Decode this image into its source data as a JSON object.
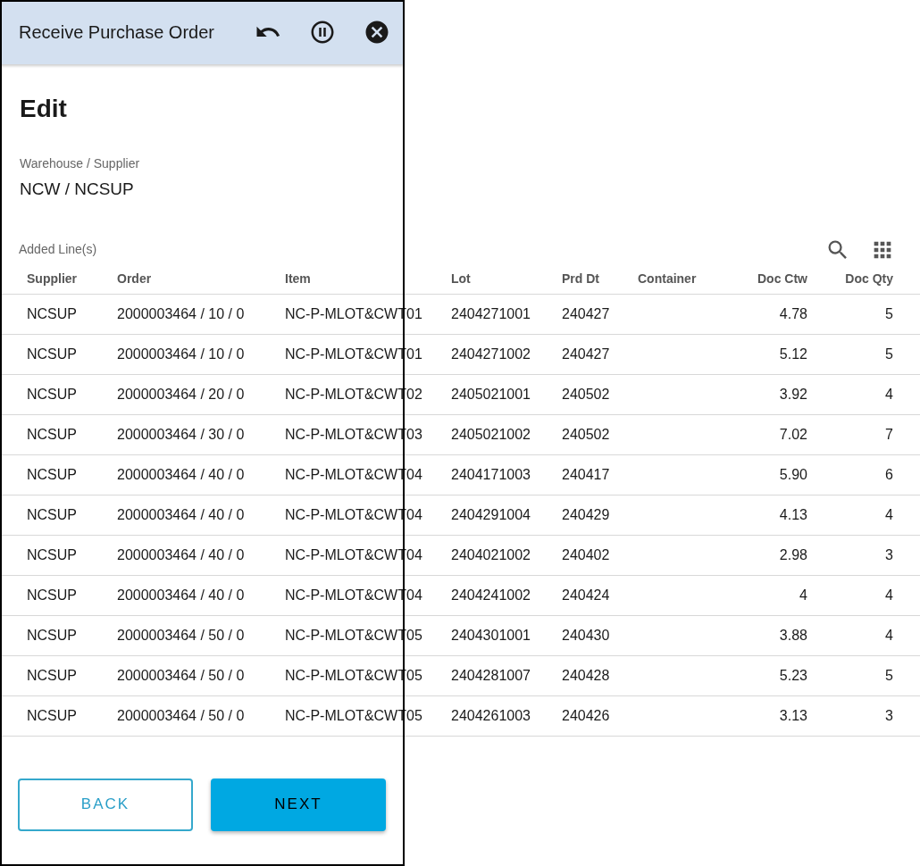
{
  "header": {
    "title": "Receive Purchase Order"
  },
  "page_title": "Edit",
  "field": {
    "label": "Warehouse / Supplier",
    "value": "NCW / NCSUP"
  },
  "section_label": "Added Line(s)",
  "table": {
    "columns": [
      "Supplier",
      "Order",
      "Item",
      "Lot",
      "Prd Dt",
      "Container",
      "Doc Ctw",
      "Doc Qty"
    ],
    "rows": [
      [
        "NCSUP",
        "2000003464 / 10 / 0",
        "NC-P-MLOT&CWT01",
        "2404271001",
        "240427",
        "",
        "4.78",
        "5"
      ],
      [
        "NCSUP",
        "2000003464 / 10 / 0",
        "NC-P-MLOT&CWT01",
        "2404271002",
        "240427",
        "",
        "5.12",
        "5"
      ],
      [
        "NCSUP",
        "2000003464 / 20 / 0",
        "NC-P-MLOT&CWT02",
        "2405021001",
        "240502",
        "",
        "3.92",
        "4"
      ],
      [
        "NCSUP",
        "2000003464 / 30 / 0",
        "NC-P-MLOT&CWT03",
        "2405021002",
        "240502",
        "",
        "7.02",
        "7"
      ],
      [
        "NCSUP",
        "2000003464 / 40 / 0",
        "NC-P-MLOT&CWT04",
        "2404171003",
        "240417",
        "",
        "5.90",
        "6"
      ],
      [
        "NCSUP",
        "2000003464 / 40 / 0",
        "NC-P-MLOT&CWT04",
        "2404291004",
        "240429",
        "",
        "4.13",
        "4"
      ],
      [
        "NCSUP",
        "2000003464 / 40 / 0",
        "NC-P-MLOT&CWT04",
        "2404021002",
        "240402",
        "",
        "2.98",
        "3"
      ],
      [
        "NCSUP",
        "2000003464 / 40 / 0",
        "NC-P-MLOT&CWT04",
        "2404241002",
        "240424",
        "",
        "4",
        "4"
      ],
      [
        "NCSUP",
        "2000003464 / 50 / 0",
        "NC-P-MLOT&CWT05",
        "2404301001",
        "240430",
        "",
        "3.88",
        "4"
      ],
      [
        "NCSUP",
        "2000003464 / 50 / 0",
        "NC-P-MLOT&CWT05",
        "2404281007",
        "240428",
        "",
        "5.23",
        "5"
      ],
      [
        "NCSUP",
        "2000003464 / 50 / 0",
        "NC-P-MLOT&CWT05",
        "2404261003",
        "240426",
        "",
        "3.13",
        "3"
      ]
    ]
  },
  "buttons": [
    {
      "label": "BACK",
      "kind": "outlined"
    },
    {
      "label": "NEXT",
      "kind": "filled"
    }
  ]
}
